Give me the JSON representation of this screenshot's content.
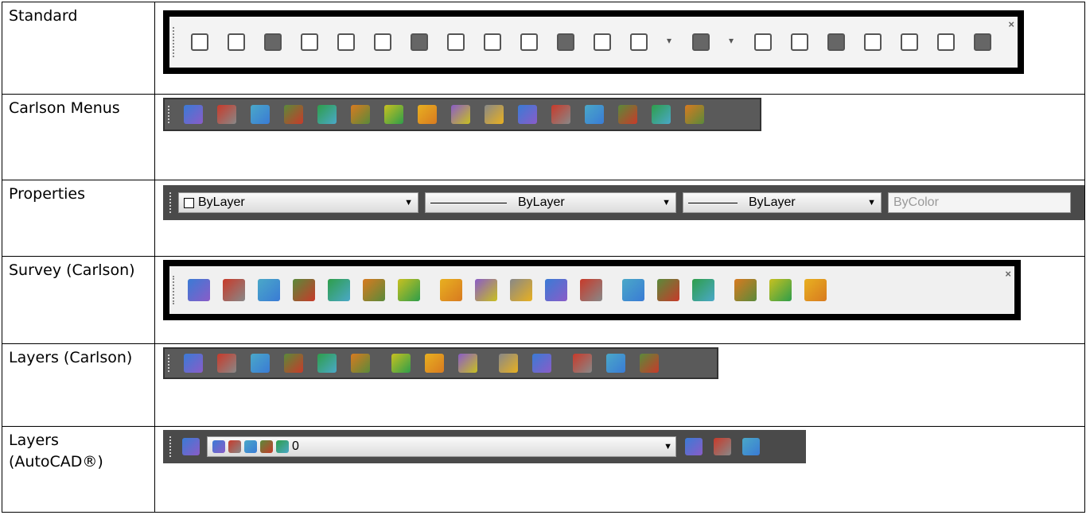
{
  "rows": [
    {
      "label": "Standard"
    },
    {
      "label": "Carlson Menus"
    },
    {
      "label": "Properties"
    },
    {
      "label": "Survey (Carlson)"
    },
    {
      "label": "Layers (Carlson)"
    },
    {
      "label": "Layers (AutoCAD®)"
    }
  ],
  "properties": {
    "color": "ByLayer",
    "linetype": "ByLayer",
    "lineweight": "ByLayer",
    "plotstyle": "ByColor"
  },
  "layer_dropdown": {
    "value": "0"
  },
  "close_glyph": "×",
  "icons": {
    "standard": [
      "qnew-icon",
      "open-icon",
      "save-icon",
      "plot-icon",
      "plot-preview-icon",
      "publish-icon",
      "3d-dwf-icon",
      "cut-icon",
      "copy-icon",
      "paste-icon",
      "match-properties-icon",
      "block-editor-icon",
      "undo-icon",
      "undo-dropdown-icon",
      "redo-icon",
      "redo-dropdown-icon",
      "properties-icon",
      "design-center-icon",
      "tool-palettes-icon",
      "sheet-set-icon",
      "markup-icon",
      "quickcalc-icon",
      "help-icon"
    ],
    "carlson": [
      "survey-menu-icon",
      "road-menu-icon",
      "hydrology-menu-icon",
      "gis-menu-icon",
      "mining-menu-icon",
      "point-menu-icon",
      "cogo-menu-icon",
      "takeoff-menu-icon",
      "field-menu-icon",
      "terrain-menu-icon",
      "utility-menu-icon",
      "tools-menu-icon",
      "geotech-menu-icon",
      "underground-menu-icon",
      "surface-mine-icon",
      "settings-menu-icon"
    ],
    "survey": [
      "surface-icon",
      "field-book-icon",
      "traverse-icon",
      "profile-icon",
      "point-list-icon",
      "checkers-icon",
      "user-icon",
      "text-icon",
      "dwg-file-icon",
      "map-icon",
      "balance-icon",
      "copy-layer-icon",
      "line-icon",
      "traverse-rule-icon",
      "sideshot-icon",
      "report-e-icon",
      "report-d-icon",
      "report-r-icon"
    ],
    "layers_carlson": [
      "layer-set-icon",
      "layer-list-icon",
      "layer-isolate-icon",
      "layer-freeze-icon",
      "layer-off-icon",
      "layer-on-icon",
      "layer-color-icon",
      "layer-raise-icon",
      "layer-add-icon",
      "layer-lock-icon",
      "layer-unlock-icon",
      "layer-walk-icon",
      "layer-restore-icon",
      "layer-match-icon"
    ],
    "layers_autocad_left": [
      "layer-manager-icon",
      "bulb-icon",
      "sun-icon",
      "viewport-freeze-icon",
      "unlock-icon",
      "color-swatch-icon"
    ],
    "layers_autocad_right": [
      "make-current-icon",
      "layer-previous-icon",
      "layer-states-icon"
    ]
  }
}
